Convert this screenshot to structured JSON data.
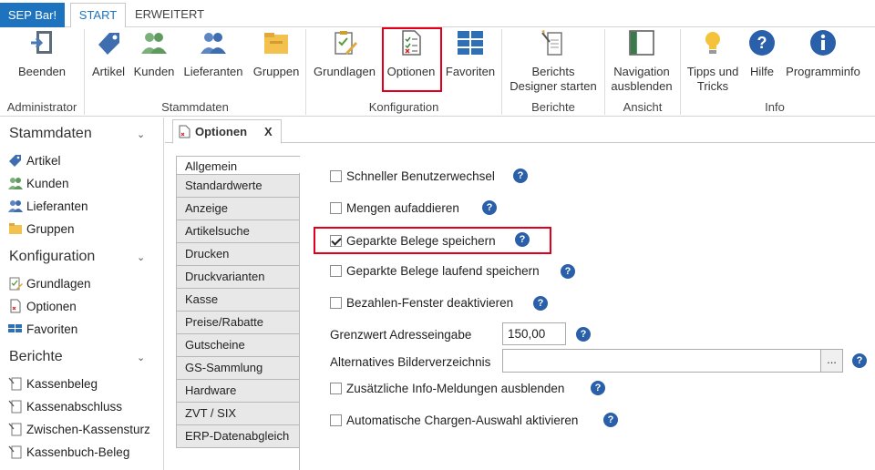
{
  "app_button": "SEP Bar!",
  "tabs": [
    "START",
    "ERWEITERT"
  ],
  "ribbon": {
    "groups": [
      {
        "label": "Administrator",
        "buttons": [
          {
            "label": "Beenden",
            "icon": "exit-icon"
          }
        ]
      },
      {
        "label": "Stammdaten",
        "buttons": [
          {
            "label": "Artikel",
            "icon": "tag-icon"
          },
          {
            "label": "Kunden",
            "icon": "customers-icon"
          },
          {
            "label": "Lieferanten",
            "icon": "suppliers-icon"
          },
          {
            "label": "Gruppen",
            "icon": "folder-icon"
          }
        ]
      },
      {
        "label": "Konfiguration",
        "buttons": [
          {
            "label": "Grundlagen",
            "icon": "clipboard-edit-icon"
          },
          {
            "label": "Optionen",
            "icon": "options-doc-icon"
          },
          {
            "label": "Favoriten",
            "icon": "grid-icon"
          }
        ]
      },
      {
        "label": "Berichte",
        "buttons": [
          {
            "label": "Berichts",
            "label2": "Designer starten",
            "icon": "report-designer-icon"
          }
        ]
      },
      {
        "label": "Ansicht",
        "buttons": [
          {
            "label": "Navigation",
            "label2": "ausblenden",
            "icon": "panel-icon"
          }
        ]
      },
      {
        "label": "Info",
        "buttons": [
          {
            "label": "Tipps und",
            "label2": "Tricks",
            "icon": "lightbulb-icon"
          },
          {
            "label": "Hilfe",
            "icon": "help-icon"
          },
          {
            "label": "Programminfo",
            "icon": "info-icon"
          }
        ]
      }
    ]
  },
  "sidebar": {
    "sections": [
      {
        "title": "Stammdaten",
        "items": [
          "Artikel",
          "Kunden",
          "Lieferanten",
          "Gruppen"
        ]
      },
      {
        "title": "Konfiguration",
        "items": [
          "Grundlagen",
          "Optionen",
          "Favoriten"
        ]
      },
      {
        "title": "Berichte",
        "items": [
          "Kassenbeleg",
          "Kassenabschluss",
          "Zwischen-Kassensturz",
          "Kassenbuch-Beleg"
        ]
      }
    ]
  },
  "doc_tab": {
    "title": "Optionen",
    "close": "X"
  },
  "options_nav": [
    "Allgemein",
    "Standardwerte",
    "Anzeige",
    "Artikelsuche",
    "Drucken",
    "Druckvarianten",
    "Kasse",
    "Preise/Rabatte",
    "Gutscheine",
    "GS-Sammlung",
    "Hardware",
    "ZVT / SIX",
    "ERP-Datenabgleich"
  ],
  "options": {
    "fast_user_switch": {
      "label": "Schneller Benutzerwechsel",
      "checked": false
    },
    "sum_quantities": {
      "label": "Mengen aufaddieren",
      "checked": false
    },
    "save_parked": {
      "label": "Geparkte Belege speichern",
      "checked": true
    },
    "save_parked_continuous": {
      "label": "Geparkte Belege laufend speichern",
      "checked": false
    },
    "disable_pay_window": {
      "label": "Bezahlen-Fenster deaktivieren",
      "checked": false
    },
    "address_threshold": {
      "label": "Grenzwert Adresseingabe",
      "value": "150,00"
    },
    "alt_image_dir": {
      "label": "Alternatives Bilderverzeichnis",
      "value": "",
      "browse": "..."
    },
    "hide_info_messages": {
      "label": "Zusätzliche Info-Meldungen ausblenden",
      "checked": false
    },
    "auto_batch_select": {
      "label": "Automatische Chargen-Auswahl aktivieren",
      "checked": false
    }
  },
  "help_glyph": "?",
  "colors": {
    "accent": "#1e73be",
    "highlight": "#e0001b",
    "help": "#2a5fa9"
  }
}
